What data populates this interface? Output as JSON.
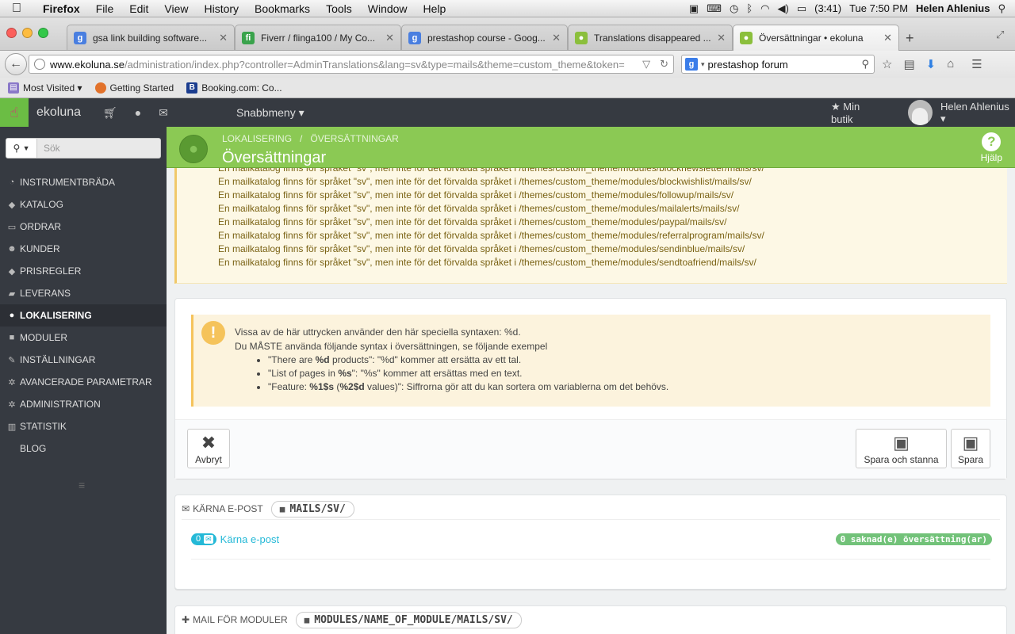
{
  "menubar": {
    "app": "Firefox",
    "items": [
      "File",
      "Edit",
      "View",
      "History",
      "Bookmarks",
      "Tools",
      "Window",
      "Help"
    ],
    "battery": "(3:41)",
    "clock": "Tue 7:50 PM",
    "user": "Helen Ahlenius"
  },
  "tabs": [
    {
      "title": "gsa link building software...",
      "favicon": "google-icon",
      "color": "#4a7fe0"
    },
    {
      "title": "Fiverr / flinga100 / My Co...",
      "favicon": "fiverr-icon",
      "color": "#3aa34c"
    },
    {
      "title": "prestashop course - Goog...",
      "favicon": "google-icon",
      "color": "#4a7fe0"
    },
    {
      "title": "Translations disappeared ...",
      "favicon": "prestashop-icon",
      "color": "#8bbf3c"
    },
    {
      "title": "Översättningar • ekoluna",
      "favicon": "prestashop-icon",
      "color": "#8bbf3c"
    }
  ],
  "url": {
    "host": "www.ekoluna.se",
    "path": "/administration/index.php?controller=AdminTranslations&lang=sv&type=mails&theme=custom_theme&token="
  },
  "search": {
    "value": "prestashop forum"
  },
  "bookmarks": [
    {
      "label": "Most Visited ▾",
      "icon": "bookmark-folder-icon",
      "color": "#8a78c9"
    },
    {
      "label": "Getting Started",
      "icon": "firefox-icon",
      "color": "#e2722b"
    },
    {
      "label": "Booking.com: Co...",
      "icon": "booking-icon",
      "color": "#1b3d8f"
    }
  ],
  "header": {
    "shop": "ekoluna",
    "quick_menu": "Snabbmeny ▾",
    "my_shop": "Min butik",
    "user": "Helen Ahlenius ▾"
  },
  "sidebar": {
    "search_placeholder": "Sök",
    "items": [
      {
        "label": "Instrumentbräda",
        "icon": "dashboard-icon",
        "glyph": "◔"
      },
      {
        "label": "Katalog",
        "icon": "tag-icon",
        "glyph": "◆"
      },
      {
        "label": "Ordrar",
        "icon": "credit-card-icon",
        "glyph": "▭"
      },
      {
        "label": "Kunder",
        "icon": "users-icon",
        "glyph": "☻"
      },
      {
        "label": "Prisregler",
        "icon": "price-tag-icon",
        "glyph": "◆"
      },
      {
        "label": "Leverans",
        "icon": "truck-icon",
        "glyph": "▰"
      },
      {
        "label": "Lokalisering",
        "icon": "globe-icon",
        "glyph": "●",
        "active": true
      },
      {
        "label": "Moduler",
        "icon": "puzzle-icon",
        "glyph": "■"
      },
      {
        "label": "Inställningar",
        "icon": "wrench-icon",
        "glyph": "✎"
      },
      {
        "label": "Avancerade parametrar",
        "icon": "cogs-icon",
        "glyph": "✲"
      },
      {
        "label": "Administration",
        "icon": "cog-icon",
        "glyph": "✲"
      },
      {
        "label": "Statistik",
        "icon": "bar-chart-icon",
        "glyph": "▥"
      },
      {
        "label": "Blog",
        "icon": "",
        "glyph": ""
      }
    ]
  },
  "toolbar": {
    "breadcrumb_1": "Lokalisering",
    "breadcrumb_sep": "/",
    "breadcrumb_2": "Översättningar",
    "title": "Översättningar",
    "help": "Hjälp"
  },
  "warnings": [
    "En mailkatalog finns för språket \"sv\", men inte för det förvalda språket i /themes/custom_theme/modules/blocknewsletter/mails/sv/",
    "En mailkatalog finns för språket \"sv\", men inte för det förvalda språket i /themes/custom_theme/modules/blockwishlist/mails/sv/",
    "En mailkatalog finns för språket \"sv\", men inte för det förvalda språket i /themes/custom_theme/modules/followup/mails/sv/",
    "En mailkatalog finns för språket \"sv\", men inte för det förvalda språket i /themes/custom_theme/modules/mailalerts/mails/sv/",
    "En mailkatalog finns för språket \"sv\", men inte för det förvalda språket i /themes/custom_theme/modules/paypal/mails/sv/",
    "En mailkatalog finns för språket \"sv\", men inte för det förvalda språket i /themes/custom_theme/modules/referralprogram/mails/sv/",
    "En mailkatalog finns för språket \"sv\", men inte för det förvalda språket i /themes/custom_theme/modules/sendinblue/mails/sv/",
    "En mailkatalog finns för språket \"sv\", men inte för det förvalda språket i /themes/custom_theme/modules/sendtoafriend/mails/sv/"
  ],
  "syntax_alert": {
    "line1": "Vissa av de här uttrycken använder den här speciella syntaxen: %d.",
    "line2": "Du MÅSTE använda följande syntax i översättningen, se följande exempel",
    "b1_pre": "\"There are ",
    "b1_bold": "%d",
    "b1_post": " products\": \"%d\" kommer att ersätta av ett tal.",
    "b2_pre": "\"List of pages in ",
    "b2_bold": "%s",
    "b2_post": "\": \"%s\" kommer att ersättas med en text.",
    "b3_pre": "\"Feature: ",
    "b3_bold1": "%1$s",
    "b3_mid": " (",
    "b3_bold2": "%2$d",
    "b3_post": " values)\": Siffrorna gör att du kan sortera om variablerna om det behövs."
  },
  "buttons": {
    "cancel": "Avbryt",
    "save_stay": "Spara och stanna",
    "save": "Spara"
  },
  "core_mail": {
    "heading": "Kärna e-post",
    "path": "MAILS/SV/",
    "count": "0",
    "link": "Kärna e-post",
    "missing": "0 saknad(e) översättning(ar)"
  },
  "module_mail": {
    "heading": "Mail för moduler",
    "path": "MODULES/NAME_OF_MODULE/MAILS/SV/"
  }
}
